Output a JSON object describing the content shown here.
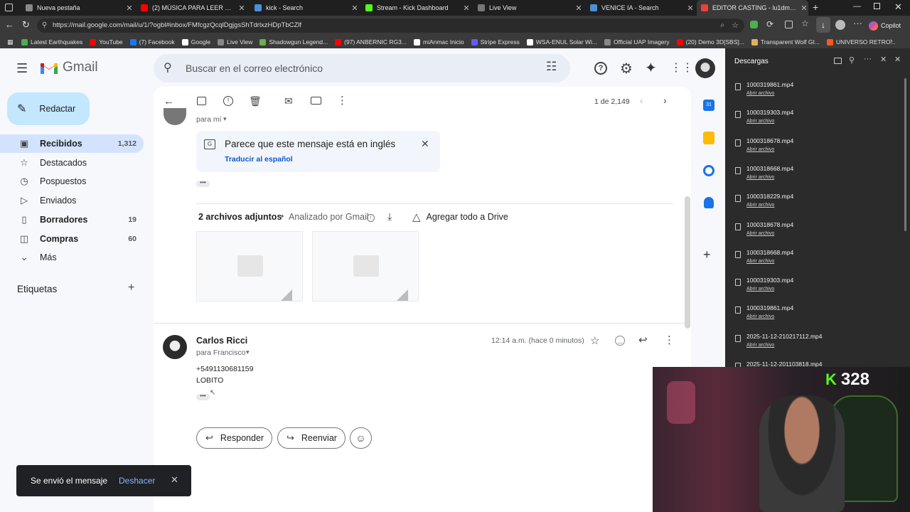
{
  "browser": {
    "tabs": [
      {
        "label": "Nueva pestaña",
        "color": "#888888"
      },
      {
        "label": "(2) MÚSICA PARA LEER TERROR Y...",
        "color": "#ff0000"
      },
      {
        "label": "kick - Search",
        "color": "#4a90d9"
      },
      {
        "label": "Stream - Kick Dashboard",
        "color": "#53fc18"
      },
      {
        "label": "Live View",
        "color": "#777777"
      },
      {
        "label": "VENICE IA - Search",
        "color": "#4a90d9"
      },
      {
        "label": "EDITOR CASTING - lu1dmx.arg@...",
        "color": "#ea4335"
      }
    ],
    "url": "https://mail.google.com/mail/u/1/?ogbl#inbox/FMfcgzQcqlDgjgsShTdrlxzHDpTbCZlf",
    "bookmarks": [
      {
        "label": "Latest Earthquakes",
        "color": "#4caf50"
      },
      {
        "label": "YouTube",
        "color": "#ff0000"
      },
      {
        "label": "(7) Facebook",
        "color": "#1877f2"
      },
      {
        "label": "Google",
        "color": "#ffffff"
      },
      {
        "label": "Live View",
        "color": "#888888"
      },
      {
        "label": "Shadowgun Legend...",
        "color": "#6ab04c"
      },
      {
        "label": "(97) ANBERNIC RG3...",
        "color": "#ff0000"
      },
      {
        "label": "miAnmac Inicio",
        "color": "#ffffff"
      },
      {
        "label": "Stripe Express",
        "color": "#635bff"
      },
      {
        "label": "WSA-ENUL Solar Wi...",
        "color": "#ffffff"
      },
      {
        "label": "Official UAP Imagery",
        "color": "#888888"
      },
      {
        "label": "(20) Demo 3D[SBS]...",
        "color": "#ff0000"
      },
      {
        "label": "Transparent Wolf GI...",
        "color": "#e0b060"
      },
      {
        "label": "UNIVERSO RETRO...",
        "color": "#ff5722"
      }
    ],
    "copilot_label": "Copilot"
  },
  "gmail": {
    "logo": "Gmail",
    "search_placeholder": "Buscar en el correo electrónico",
    "compose": "Redactar",
    "nav": [
      {
        "label": "Recibidos",
        "count": "1,312",
        "icon": "inbox-icon"
      },
      {
        "label": "Destacados",
        "count": "",
        "icon": "star-icon"
      },
      {
        "label": "Pospuestos",
        "count": "",
        "icon": "clock-icon"
      },
      {
        "label": "Enviados",
        "count": "",
        "icon": "send-icon"
      },
      {
        "label": "Borradores",
        "count": "19",
        "icon": "draft-icon"
      },
      {
        "label": "Compras",
        "count": "60",
        "icon": "shopping-icon"
      },
      {
        "label": "Más",
        "count": "",
        "icon": "chevron-down-icon"
      }
    ],
    "labels_heading": "Etiquetas",
    "pagination": "1 de 2,149",
    "message1": {
      "to": "para mí",
      "translate_banner": "Parece que este mensaje está en inglés",
      "translate_link": "Traducir al español",
      "attachments_title": "2 archivos adjuntos",
      "attachments_scanned": "Analizado por Gmail",
      "add_to_drive": "Agregar todo a Drive"
    },
    "message2": {
      "sender": "Carlos Ricci",
      "to": "para Francisco",
      "time": "12:14 a.m. (hace 0 minutos)",
      "body_line1": "+5491130681159",
      "body_line2": "LOBITO"
    },
    "reply": "Responder",
    "forward": "Reenviar",
    "toast": {
      "text": "Se envió el mensaje",
      "undo": "Deshacer"
    }
  },
  "downloads": {
    "title": "Descargas",
    "open_label": "Abrir archivo",
    "items": [
      "1000319861.mp4",
      "1000319303.mp4",
      "1000318678.mp4",
      "1000318668.mp4",
      "1000318229.mp4",
      "1000318678.mp4",
      "1000318668.mp4",
      "1000319303.mp4",
      "1000319861.mp4",
      "2025-11-12-210217112.mp4",
      "2025-11-12-201103818.mp4"
    ]
  },
  "stream_overlay": {
    "viewer_count": "328",
    "badge": "K"
  }
}
